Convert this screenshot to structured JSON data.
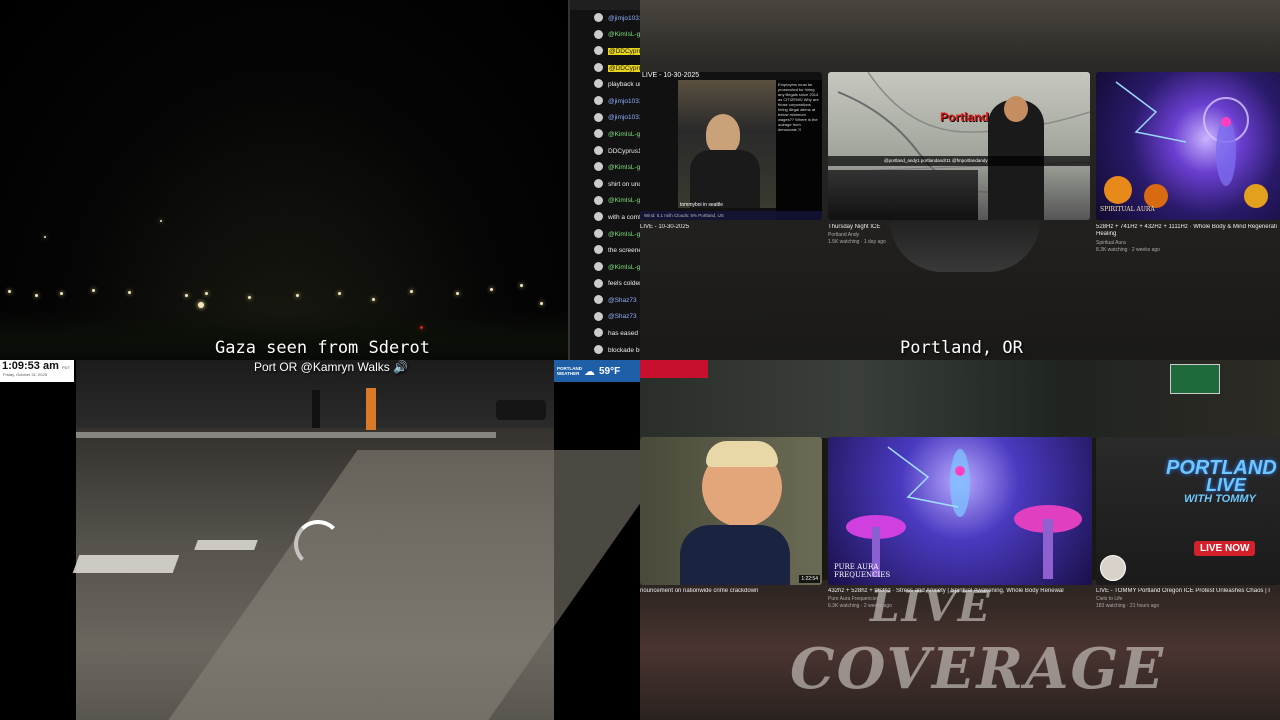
{
  "top_left": {
    "caption": "Gaza seen from Sderot"
  },
  "chat": {
    "messages": [
      {
        "user": "@jimjo1031",
        "color": "blue"
      },
      {
        "user": "@KimIsL-g2r",
        "color": "green"
      },
      {
        "user": "@DDCyprus1C",
        "color": "hl"
      },
      {
        "user": "@DDCyprus1C",
        "color": "hl"
      },
      {
        "user": "playback until w",
        "color": "text"
      },
      {
        "user": "@jimjo1031",
        "color": "blue"
      },
      {
        "user": "@jimjo1031",
        "color": "blue"
      },
      {
        "user": "@KimIsL-g2r",
        "color": "green"
      },
      {
        "user": "DDCyprus1Clid",
        "color": "text"
      },
      {
        "user": "@KimIsL-g2r",
        "color": "green"
      },
      {
        "user": "shirt on under r",
        "color": "text"
      },
      {
        "user": "@KimIsL-g2r",
        "color": "green"
      },
      {
        "user": "with a comfort",
        "color": "text"
      },
      {
        "user": "@KimIsL-g2r",
        "color": "green"
      },
      {
        "user": "the screened in",
        "color": "text"
      },
      {
        "user": "@KimIsL-g2r",
        "color": "green"
      },
      {
        "user": "feels colder w",
        "color": "text"
      },
      {
        "user": "@Shaz73",
        "color": "blue"
      },
      {
        "user": "@Shaz73",
        "color": "blue"
      },
      {
        "user": "has eased the",
        "color": "text"
      },
      {
        "user": "blockade but a",
        "color": "text"
      }
    ]
  },
  "top_right": {
    "caption": "Portland, OR",
    "cards": [
      {
        "title": "LIVE - 10-30-2025",
        "meta": "",
        "overlay_top": "LIVE - 10-30-2025",
        "overlay_caption": "tommyboi in seattle",
        "stats": "Wind: 5.1 mi/h   Clouds: 5%   Portland, US"
      },
      {
        "title": "Thursday Night ICE",
        "meta": "Portland Andy",
        "meta2": "1.5K watching · 1 day ago",
        "overlay_name": "Portland Andy",
        "overlay_social": "@portland_andy1   portlandandr11   @fmportlandandy"
      },
      {
        "title": "528Hz + 741Hz + 432Hz + 1111Hz · Whole Body & Mind Regenerati",
        "title2": "Healing",
        "meta": "Spiritual Aura",
        "meta2": "8.3K watching · 2 weeks ago",
        "overlay_brand": "SPIRITUAL AURA"
      }
    ],
    "chat_overlay": "Employers must be prosecuted for hiring any illegals since 2014 as CITIZENS! Why are those corporations hiring illegal aliens at below minimum wages?? Where is the outrage from democrats ?!"
  },
  "bottom_left": {
    "clock_time": "1:09:53 am",
    "clock_tz": "PDT",
    "clock_date": "Friday, October 31, 2025",
    "cam_title": "Port OR @Kamryn Walks",
    "weather_label": "PORTLAND WEATHER",
    "weather_temp": "59°F"
  },
  "bottom_right": {
    "cards": [
      {
        "title": "nouncement on nationwide crime crackdown",
        "meta": "",
        "duration": "1:22:54"
      },
      {
        "title": "432hz + 528hz + 963hz · Stress and Anxiety | Spiritual Awakening, Whole Body Renewal",
        "meta": "Pure Aura Frequencies",
        "meta2": "6.3K watching · 2 weeks ago",
        "overlay_brand": "PURE AURA FREQUENCIES"
      },
      {
        "title": "LIVE - TOMMY Portland Oregon ICE Protest Unleashes Chaos | I",
        "meta": "Cielo to Life",
        "meta2": "183 watching · 21 hours ago",
        "overlay_title_1": "PORTLAND",
        "overlay_title_2": "LIVE",
        "overlay_title_3": "WITH TOMMY",
        "live_badge": "LIVE NOW"
      }
    ],
    "banner_1": "LIVE",
    "banner_2": "COVERAGE"
  }
}
